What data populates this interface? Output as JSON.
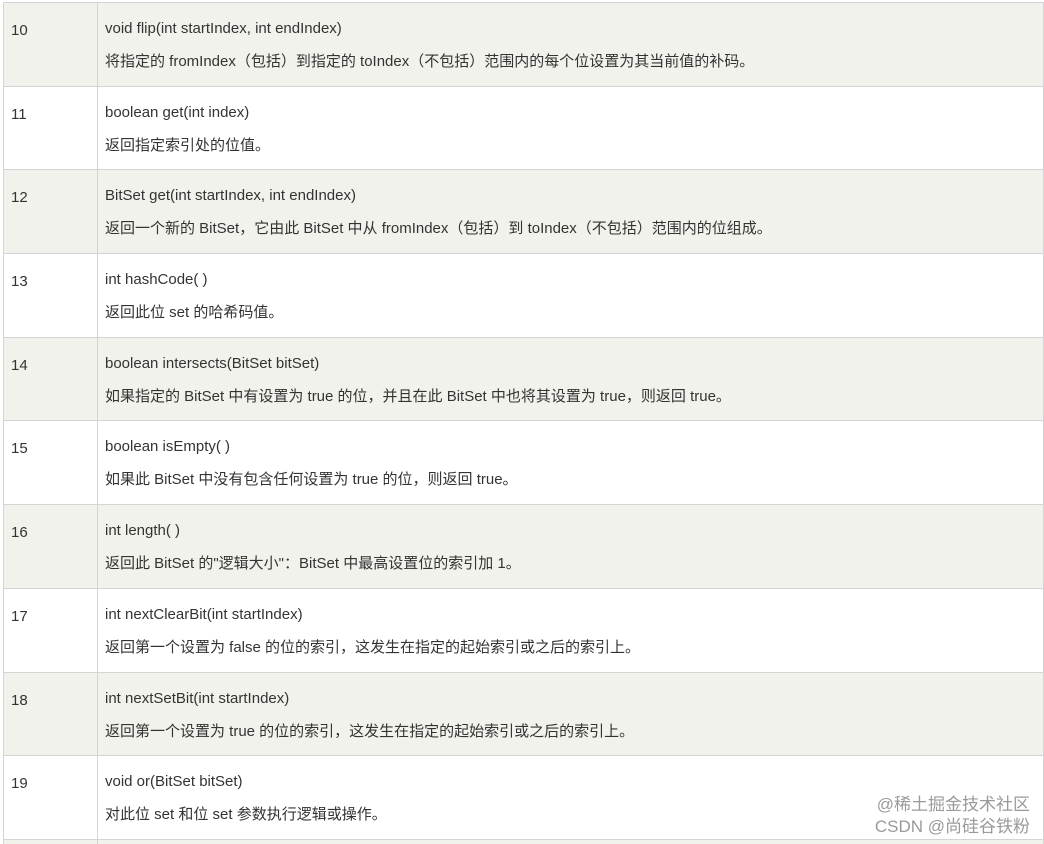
{
  "rows": [
    {
      "number": "10",
      "signature": "void flip(int startIndex, int endIndex)",
      "description": "将指定的 fromIndex（包括）到指定的 toIndex（不包括）范围内的每个位设置为其当前值的补码。"
    },
    {
      "number": "11",
      "signature": "boolean get(int index)",
      "description": "返回指定索引处的位值。"
    },
    {
      "number": "12",
      "signature": "BitSet get(int startIndex, int endIndex)",
      "description": "返回一个新的 BitSet，它由此 BitSet 中从 fromIndex（包括）到 toIndex（不包括）范围内的位组成。"
    },
    {
      "number": "13",
      "signature": "int hashCode( )",
      "description": "返回此位 set 的哈希码值。"
    },
    {
      "number": "14",
      "signature": "boolean intersects(BitSet bitSet)",
      "description": "如果指定的 BitSet 中有设置为 true 的位，并且在此 BitSet 中也将其设置为 true，则返回 true。"
    },
    {
      "number": "15",
      "signature": "boolean isEmpty( )",
      "description": "如果此 BitSet 中没有包含任何设置为 true 的位，则返回 true。"
    },
    {
      "number": "16",
      "signature": "int length( )",
      "description": "返回此 BitSet 的\"逻辑大小\"：BitSet 中最高设置位的索引加 1。"
    },
    {
      "number": "17",
      "signature": "int nextClearBit(int startIndex)",
      "description": "返回第一个设置为 false 的位的索引，这发生在指定的起始索引或之后的索引上。"
    },
    {
      "number": "18",
      "signature": "int nextSetBit(int startIndex)",
      "description": "返回第一个设置为 true 的位的索引，这发生在指定的起始索引或之后的索引上。"
    },
    {
      "number": "19",
      "signature": "void or(BitSet bitSet)",
      "description": "对此位 set 和位 set 参数执行逻辑或操作。"
    }
  ],
  "watermark": {
    "line1": "@稀土掘金技术社区",
    "line2": "CSDN @尚硅谷铁粉"
  },
  "colors": {
    "shaded_row": "#f2f2ec",
    "plain_row": "#ffffff",
    "border": "#d4d4d4",
    "text": "#333333"
  }
}
